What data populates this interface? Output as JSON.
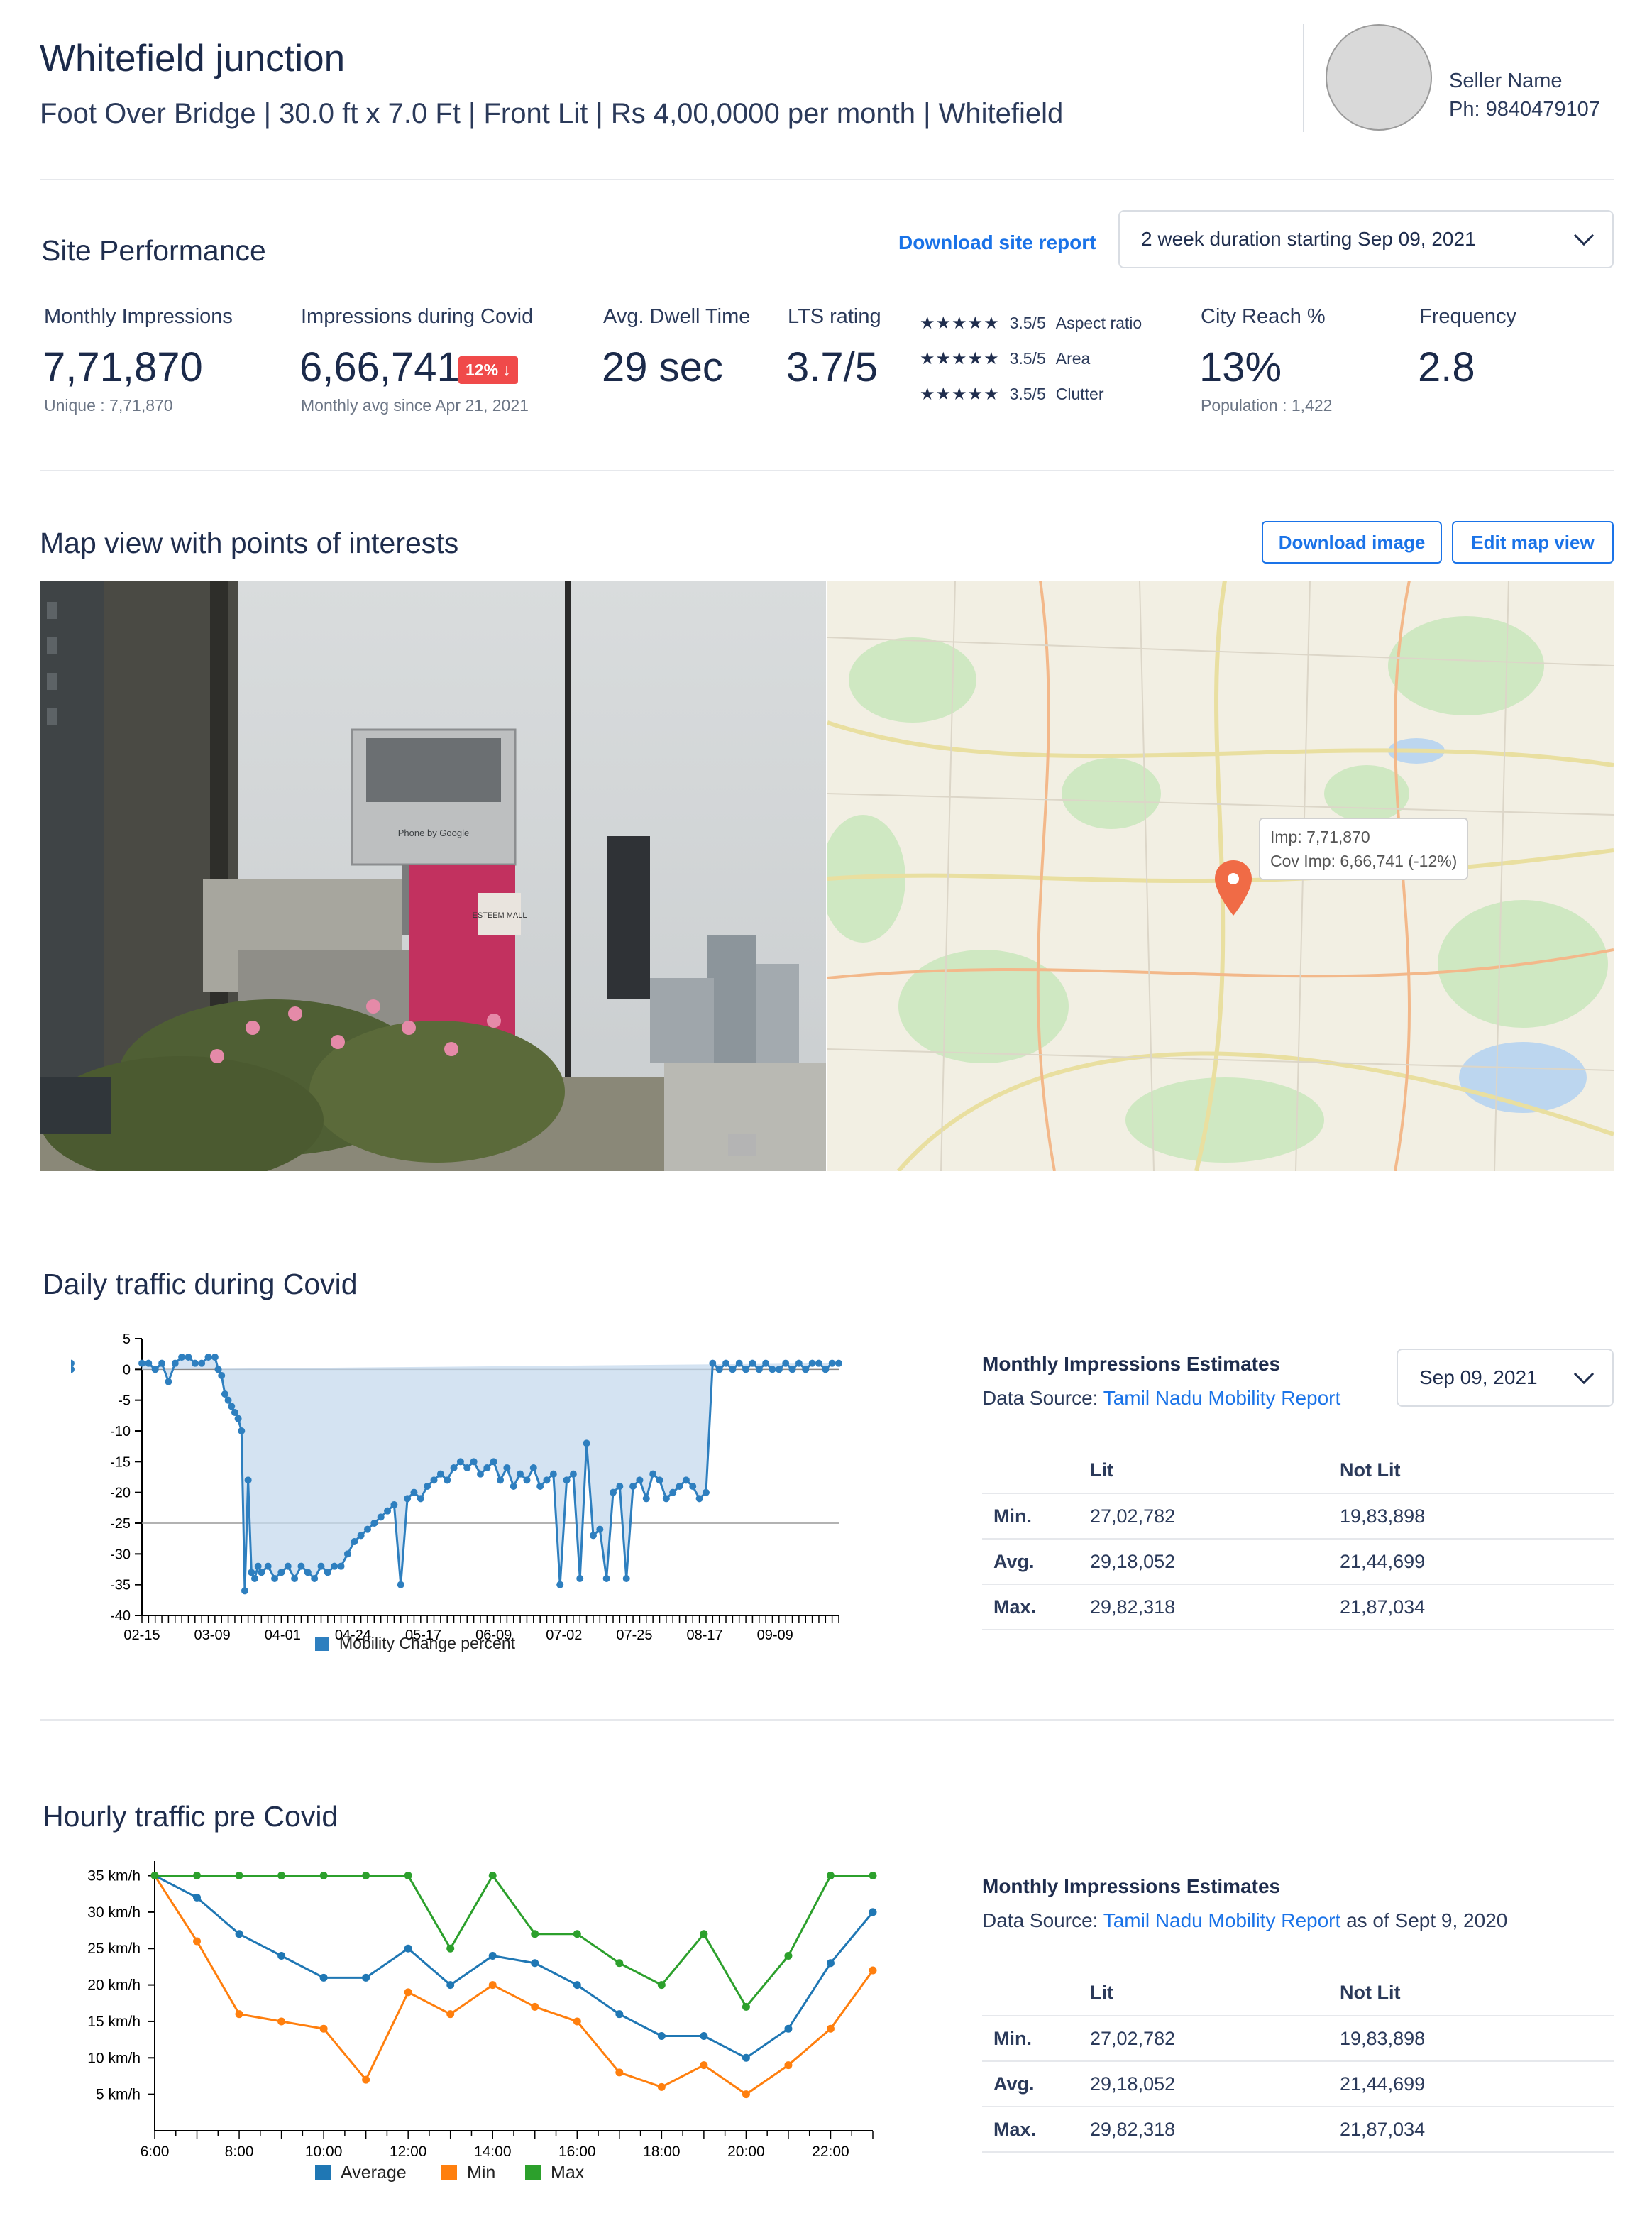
{
  "site": {
    "title": "Whitefield junction",
    "subtitle": "Foot Over Bridge | 30.0 ft x 7.0 Ft | Front Lit | Rs 4,00,0000 per month | Whitefield"
  },
  "seller": {
    "name": "Seller Name",
    "phone": "Ph: 9840479107"
  },
  "performance": {
    "title": "Site Performance",
    "download_label": "Download site report",
    "duration": "2 week duration starting Sep 09, 2021",
    "metrics": {
      "monthly": {
        "label": "Monthly Impressions",
        "value": "7,71,870",
        "sub": "Unique : 7,71,870"
      },
      "covid": {
        "label": "Impressions during Covid",
        "value": "6,66,741",
        "badge": "12%",
        "sub": "Monthly avg since Apr 21, 2021"
      },
      "dwell": {
        "label": "Avg. Dwell Time",
        "value": "29 sec"
      },
      "lts": {
        "label": "LTS rating",
        "value": "3.7/5"
      },
      "ratings": [
        {
          "stars": "★★★★★",
          "score": "3.5/5",
          "name": "Aspect ratio"
        },
        {
          "stars": "★★★★★",
          "score": "3.5/5",
          "name": "Area"
        },
        {
          "stars": "★★★★★",
          "score": "3.5/5",
          "name": "Clutter"
        }
      ],
      "reach": {
        "label": "City Reach %",
        "value": "13%",
        "sub": "Population : 1,422"
      },
      "frequency": {
        "label": "Frequency",
        "value": "2.8"
      }
    }
  },
  "map_section": {
    "title": "Map view with points of interests",
    "download_image": "Download image",
    "edit_map": "Edit map view",
    "tooltip_imp": "Imp: 7,71,870",
    "tooltip_cov": "Cov Imp: 6,66,741 (-12%)",
    "photo_signs": {
      "billboard": "Phone by Google",
      "mall": "ESTEEM MALL"
    }
  },
  "daily": {
    "title": "Daily traffic during Covid",
    "estimates_title": "Monthly Impressions Estimates",
    "source_prefix": "Data Source: ",
    "source_link": "Tamil Nadu Mobility Report",
    "date": "Sep 09, 2021",
    "col_lit": "Lit",
    "col_notlit": "Not Lit",
    "rows": [
      {
        "label": "Min.",
        "lit": "27,02,782",
        "notlit": "19,83,898"
      },
      {
        "label": "Avg.",
        "lit": "29,18,052",
        "notlit": "21,44,699"
      },
      {
        "label": "Max.",
        "lit": "29,82,318",
        "notlit": "21,87,034"
      }
    ]
  },
  "hourly": {
    "title": "Hourly traffic pre Covid",
    "estimates_title": "Monthly Impressions Estimates",
    "source_prefix": "Data Source: ",
    "source_link": "Tamil Nadu Mobility Report",
    "source_suffix": "as of Sept 9, 2020",
    "col_lit": "Lit",
    "col_notlit": "Not Lit",
    "rows": [
      {
        "label": "Min.",
        "lit": "27,02,782",
        "notlit": "19,83,898"
      },
      {
        "label": "Avg.",
        "lit": "29,18,052",
        "notlit": "21,44,699"
      },
      {
        "label": "Max.",
        "lit": "29,82,318",
        "notlit": "21,87,034"
      }
    ]
  },
  "chart_data": [
    {
      "type": "area",
      "legend": [
        "Mobility Change percent"
      ],
      "legend_position": "bottom",
      "x_ticks": [
        "02-15",
        "03-09",
        "04-01",
        "04-24",
        "05-17",
        "06-09",
        "07-02",
        "07-25",
        "08-17",
        "09-09"
      ],
      "y_ticks": [
        5,
        0,
        -5,
        -10,
        -15,
        -20,
        -25,
        -30,
        -35,
        -40
      ],
      "ylim": [
        -40,
        5
      ],
      "reference_line": -25,
      "color": "#2e7fbf",
      "series": [
        {
          "name": "Mobility Change percent",
          "x_index": [
            0,
            2,
            4,
            6,
            8,
            10,
            12,
            14,
            16,
            18,
            20,
            22,
            23,
            24,
            25,
            26,
            27,
            28,
            29,
            30,
            31,
            32,
            33,
            34,
            35,
            36,
            38,
            40,
            42,
            44,
            46,
            48,
            50,
            52,
            54,
            56,
            58,
            60,
            62,
            64,
            66,
            68,
            70,
            72,
            74,
            76,
            78,
            80,
            82,
            84,
            86,
            88,
            90,
            92,
            94,
            96,
            98,
            100,
            102,
            104,
            106,
            108,
            110,
            112,
            114,
            116,
            118,
            120,
            122,
            124,
            126,
            128,
            130,
            132,
            134,
            136,
            138,
            140,
            142,
            144,
            146,
            148,
            150,
            152,
            154,
            156,
            158,
            160,
            162,
            164,
            166,
            168,
            170,
            172,
            174,
            176,
            178,
            180,
            182,
            184,
            186,
            188,
            190,
            192,
            194,
            196,
            198,
            200,
            202,
            204,
            206,
            208,
            210
          ],
          "values": [
            1,
            1,
            0,
            1,
            -2,
            1,
            2,
            2,
            1,
            1,
            2,
            2,
            0,
            -1,
            -4,
            -5,
            -6,
            -7,
            -8,
            -10,
            -36,
            -18,
            -33,
            -34,
            -32,
            -33,
            -32,
            -34,
            -33,
            -32,
            -34,
            -32,
            -33,
            -34,
            -32,
            -33,
            -32,
            -32,
            -30,
            -28,
            -27,
            -26,
            -25,
            -24,
            -23,
            -22,
            -35,
            -21,
            -20,
            -21,
            -19,
            -18,
            -17,
            -18,
            -16,
            -15,
            -16,
            -15,
            -17,
            -16,
            -15,
            -18,
            -16,
            -19,
            -17,
            -18,
            -16,
            -19,
            -18,
            -17,
            -35,
            -18,
            -17,
            -34,
            -12,
            -27,
            -26,
            -34,
            -20,
            -19,
            -34,
            -19,
            -18,
            -21,
            -17,
            -18,
            -21,
            -20,
            -19,
            -18,
            -19,
            -21,
            -20,
            1,
            0,
            1,
            0,
            1,
            0,
            1,
            0,
            1,
            0,
            0,
            1,
            0,
            1,
            0,
            1,
            1,
            0,
            1,
            1,
            0,
            1
          ]
        }
      ]
    },
    {
      "type": "line",
      "legend": [
        "Average",
        "Min",
        "Max"
      ],
      "legend_position": "bottom",
      "x_ticks": [
        "6:00",
        "8:00",
        "10:00",
        "12:00",
        "14:00",
        "16:00",
        "18:00",
        "20:00",
        "22:00"
      ],
      "y_ticks": [
        "5 km/h",
        "10 km/h",
        "15 km/h",
        "20 km/h",
        "25 km/h",
        "30 km/h",
        "35 km/h"
      ],
      "ylim": [
        0,
        37
      ],
      "x_hours": [
        6,
        7,
        8,
        9,
        10,
        11,
        12,
        13,
        14,
        15,
        16,
        17,
        18,
        19,
        20,
        21,
        22,
        23
      ],
      "series": [
        {
          "name": "Average",
          "color": "#1f77b4",
          "values": [
            35,
            32,
            27,
            24,
            21,
            21,
            25,
            20,
            24,
            23,
            20,
            16,
            13,
            13,
            10,
            14,
            23,
            30
          ]
        },
        {
          "name": "Min",
          "color": "#ff7f0e",
          "values": [
            35,
            26,
            16,
            15,
            14,
            7,
            19,
            16,
            20,
            17,
            15,
            8,
            6,
            9,
            5,
            9,
            14,
            22
          ]
        },
        {
          "name": "Max",
          "color": "#2ca02c",
          "values": [
            35,
            35,
            35,
            35,
            35,
            35,
            35,
            25,
            35,
            27,
            27,
            23,
            20,
            27,
            17,
            24,
            35,
            35
          ]
        }
      ]
    }
  ]
}
